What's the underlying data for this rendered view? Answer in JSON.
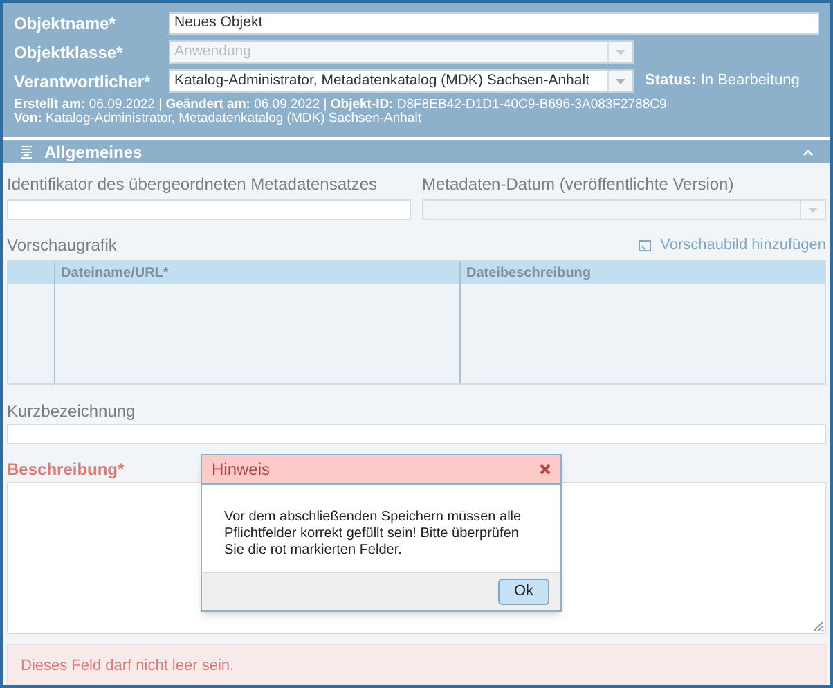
{
  "header": {
    "fields": [
      {
        "label": "Objektname*",
        "kind": "text",
        "value": "Neues Objekt",
        "disabled": false
      },
      {
        "label": "Objektklasse*",
        "kind": "select",
        "value": "Anwendung",
        "disabled": true
      },
      {
        "label": "Verantwortlicher*",
        "kind": "select",
        "value": "Katalog-Administrator, Metadatenkatalog (MDK) Sachsen-Anhalt",
        "disabled": false
      }
    ],
    "status": {
      "label": "Status:",
      "value": "In Bearbeitung"
    },
    "meta": "**Erstellt am:** 06.09.2022 | **Geändert am:** 06.09.2022 | **Objekt-ID:** D8F8EB42-D1D1-40C9-B696-3A083F2788C9",
    "author": "**Von:** Katalog-Administrator, Metadatenkatalog (MDK) Sachsen-Anhalt"
  },
  "section": {
    "title": "Allgemeines",
    "expanded": true
  },
  "parent_identifier": {
    "label": "Identifikator des übergeordneten Metadatensatzes"
  },
  "metadata_date": {
    "label": "Metadaten-Datum (veröffentlichte Version)",
    "disabled": true
  },
  "preview": {
    "title": "Vorschaugrafik",
    "add_link": "Vorschaubild hinzufügen",
    "columns": [
      "Dateiname/URL*",
      "Dateibeschreibung"
    ]
  },
  "short_name": {
    "label": "Kurzbezeichnung"
  },
  "description": {
    "label": "Beschreibung*",
    "invalid": true,
    "error": "Dieses Feld darf nicht leer sein."
  },
  "dialog": {
    "title": "Hinweis",
    "message": "Vor dem abschließenden Speichern müssen alle Pflichtfelder korrekt gefüllt sein! Bitte überprüfen Sie die rot markierten Felder.",
    "button": "Ok"
  }
}
